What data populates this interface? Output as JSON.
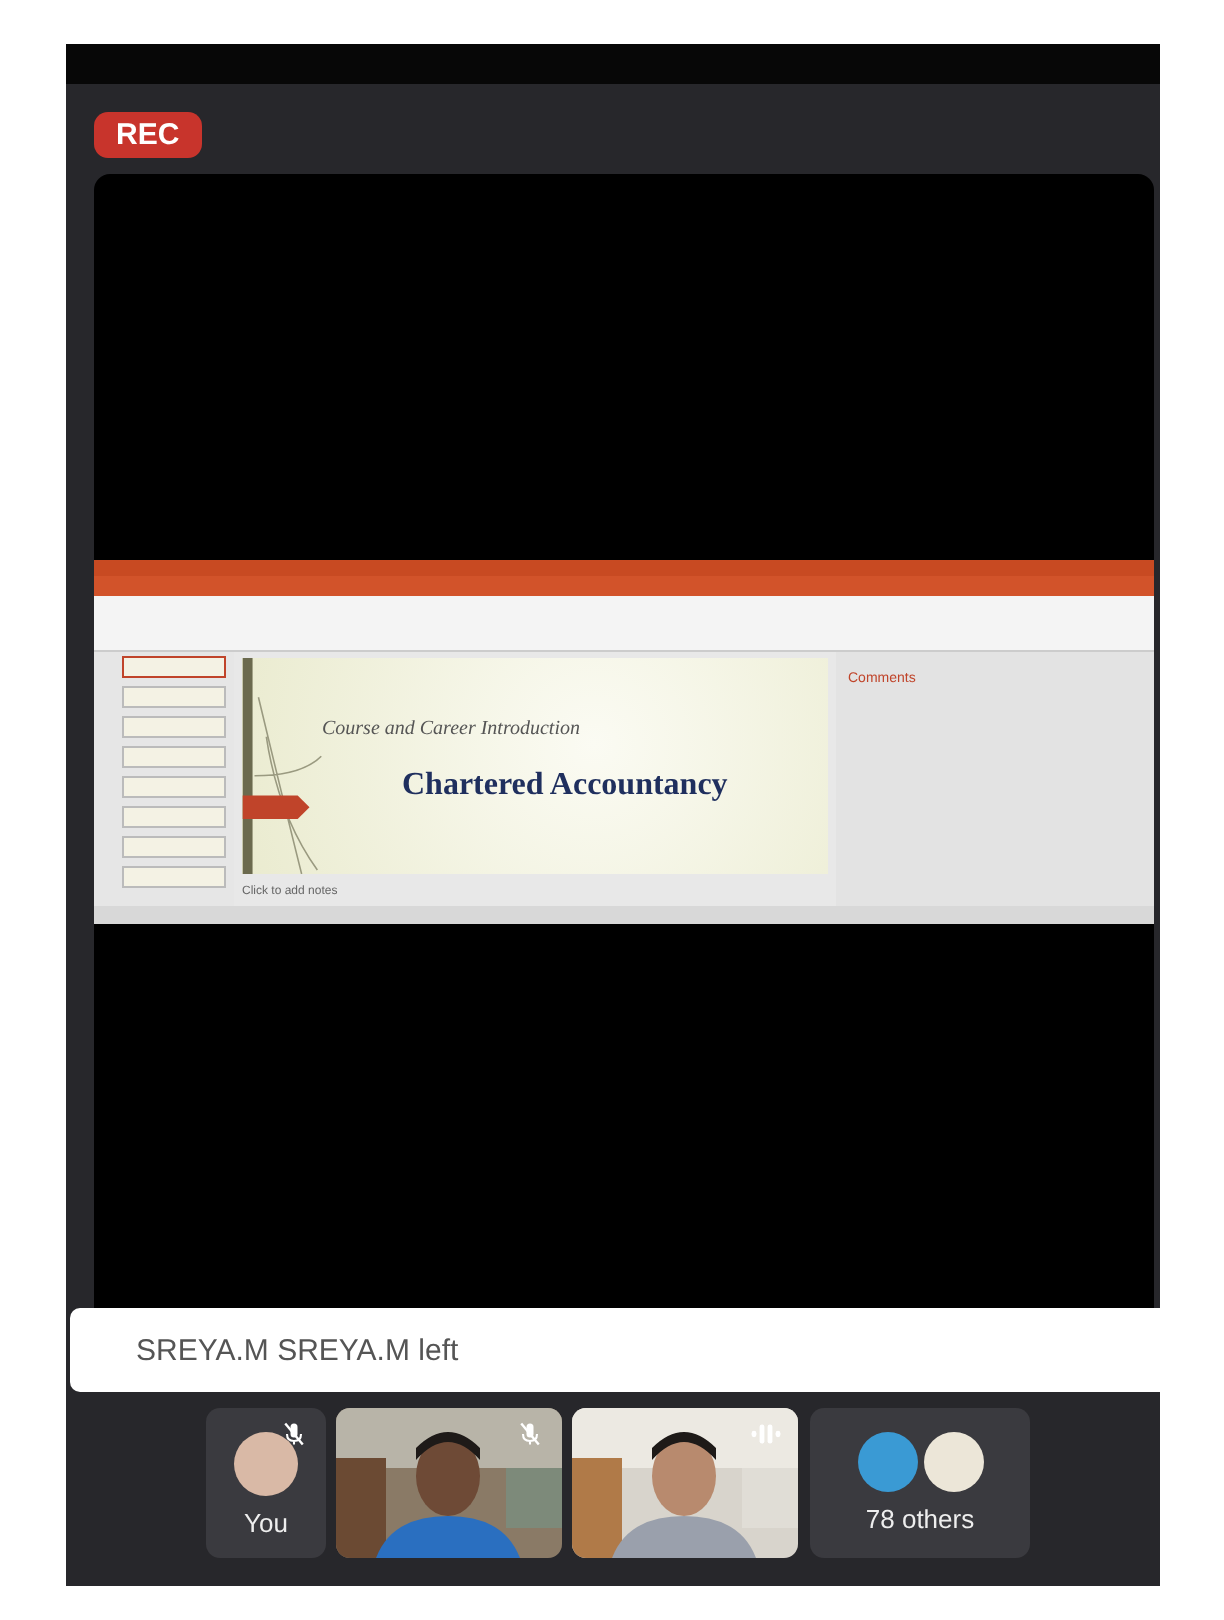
{
  "recording": {
    "badge": "REC"
  },
  "presentation": {
    "thumbnails": [
      {
        "selected": true
      },
      {
        "selected": false
      },
      {
        "selected": false
      },
      {
        "selected": false
      },
      {
        "selected": false
      },
      {
        "selected": false
      },
      {
        "selected": false
      },
      {
        "selected": false
      }
    ],
    "slide": {
      "subtitle": "Course and Career Introduction",
      "title": "Chartered Accountancy"
    },
    "notes_placeholder": "Click to add notes",
    "comments_pane": {
      "title": "Comments"
    }
  },
  "toast": "SREYA.M SREYA.M left",
  "participants": [
    {
      "kind": "avatar",
      "label": "You",
      "muted": true,
      "speaking": false
    },
    {
      "kind": "video",
      "muted": true,
      "speaking": false
    },
    {
      "kind": "video",
      "muted": false,
      "speaking": true
    },
    {
      "kind": "group",
      "label": "78 others",
      "muted": false,
      "speaking": false
    }
  ]
}
